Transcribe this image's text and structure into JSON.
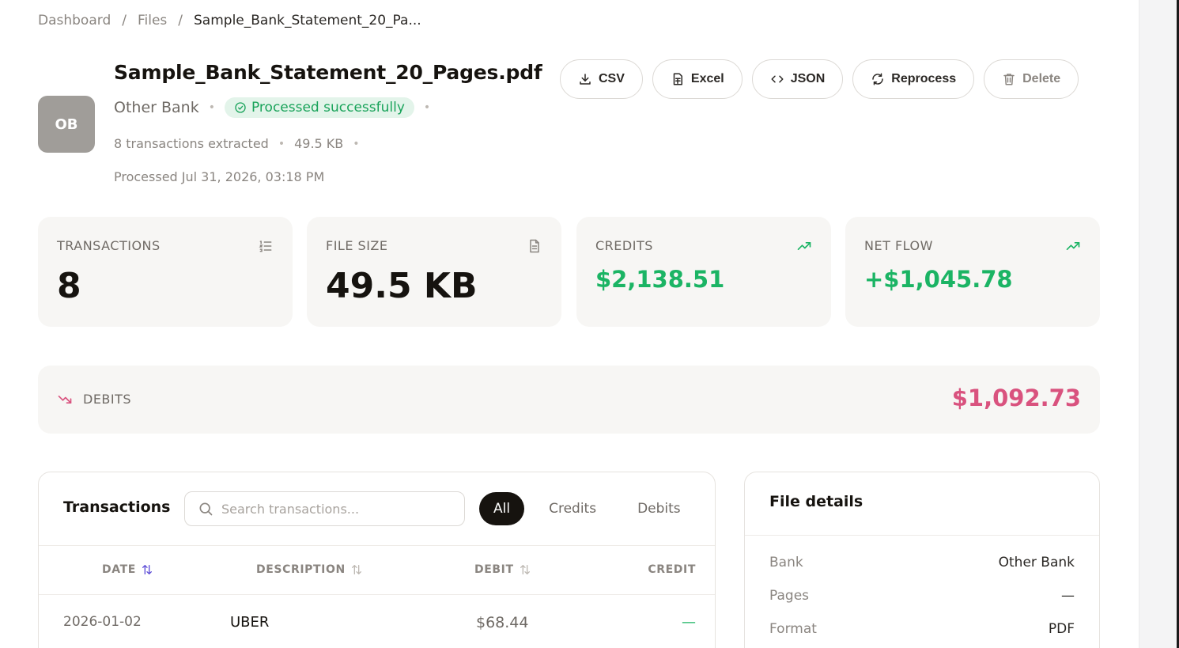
{
  "breadcrumb": {
    "items": [
      "Dashboard",
      "Files"
    ],
    "current": "Sample_Bank_Statement_20_Pa...",
    "separator": "/"
  },
  "file": {
    "avatar": "OB",
    "title": "Sample_Bank_Statement_20_Pages.pdf",
    "bank": "Other Bank",
    "status": "Processed successfully",
    "transactions_text": "8 transactions extracted",
    "size_text": "49.5 KB",
    "processed_text": "Processed Jul 31, 2026, 03:18 PM"
  },
  "actions": {
    "csv": "CSV",
    "excel": "Excel",
    "json": "JSON",
    "reprocess": "Reprocess",
    "delete": "Delete"
  },
  "stats": {
    "transactions": {
      "label": "TRANSACTIONS",
      "value": "8"
    },
    "file_size": {
      "label": "FILE SIZE",
      "value": "49.5 KB"
    },
    "credits": {
      "label": "CREDITS",
      "value": "$2,138.51"
    },
    "net_flow": {
      "label": "NET FLOW",
      "value": "+$1,045.78"
    },
    "debits": {
      "label": "DEBITS",
      "value": "$1,092.73"
    }
  },
  "transactions_panel": {
    "title": "Transactions",
    "search_placeholder": "Search transactions...",
    "filters": [
      "All",
      "Credits",
      "Debits"
    ],
    "columns": {
      "date": "DATE",
      "description": "DESCRIPTION",
      "debit": "DEBIT",
      "credit": "CREDIT"
    },
    "rows": [
      {
        "date": "2026-01-02",
        "description": "UBER",
        "debit": "$68.44",
        "credit": "—"
      }
    ]
  },
  "file_details": {
    "title": "File details",
    "rows": [
      {
        "key": "Bank",
        "value": "Other Bank"
      },
      {
        "key": "Pages",
        "value": "—"
      },
      {
        "key": "Format",
        "value": "PDF"
      }
    ]
  },
  "colors": {
    "accent_green": "#1bb464",
    "debit_pink": "#d9527e",
    "sort_active": "#5b4bd6",
    "status_bg": "#e3f4ea"
  }
}
